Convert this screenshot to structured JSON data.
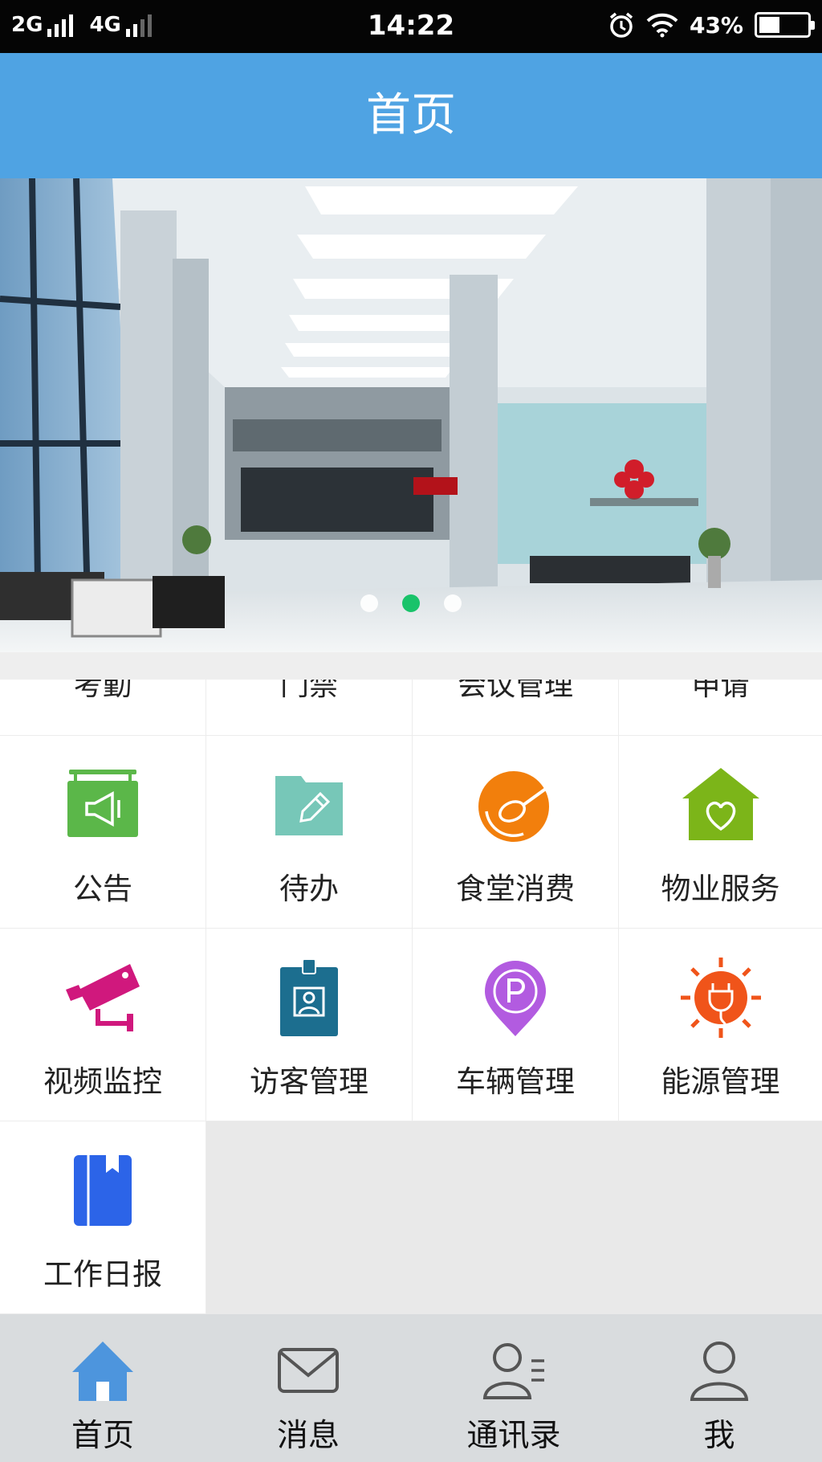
{
  "status_bar": {
    "network1": "2G",
    "network2": "4G",
    "time": "14:22",
    "battery": "43%",
    "battery_level": 0.43
  },
  "header": {
    "title": "首页"
  },
  "banner": {
    "slide_count": 3,
    "active_slide": 2
  },
  "grid": {
    "partial_row": [
      "考勤",
      "门禁",
      "会议管理",
      "申请"
    ],
    "row1": [
      {
        "label": "公告",
        "icon": "announcement-icon"
      },
      {
        "label": "待办",
        "icon": "todo-folder-icon"
      },
      {
        "label": "食堂消费",
        "icon": "canteen-spoon-icon"
      },
      {
        "label": "物业服务",
        "icon": "property-house-icon"
      }
    ],
    "row2": [
      {
        "label": "视频监控",
        "icon": "cctv-camera-icon"
      },
      {
        "label": "访客管理",
        "icon": "visitor-badge-icon"
      },
      {
        "label": "车辆管理",
        "icon": "parking-pin-icon"
      },
      {
        "label": "能源管理",
        "icon": "energy-plug-icon"
      }
    ],
    "row3": [
      {
        "label": "工作日报",
        "icon": "daily-report-book-icon"
      }
    ]
  },
  "tabbar": {
    "tabs": [
      {
        "label": "首页",
        "icon": "home-icon",
        "active": true
      },
      {
        "label": "消息",
        "icon": "envelope-icon"
      },
      {
        "label": "通讯录",
        "icon": "contacts-icon"
      },
      {
        "label": "我",
        "icon": "user-icon"
      }
    ]
  },
  "colors": {
    "header": "#4fa3e3",
    "active_dot": "#19c36a",
    "announcement": "#5bb749",
    "todo": "#77c7b8",
    "canteen": "#f27f0c",
    "property": "#7cb519",
    "cctv": "#d0187d",
    "visitor": "#1c6e8f",
    "parking": "#b25be0",
    "energy": "#f0541a",
    "report": "#2c64e8"
  }
}
